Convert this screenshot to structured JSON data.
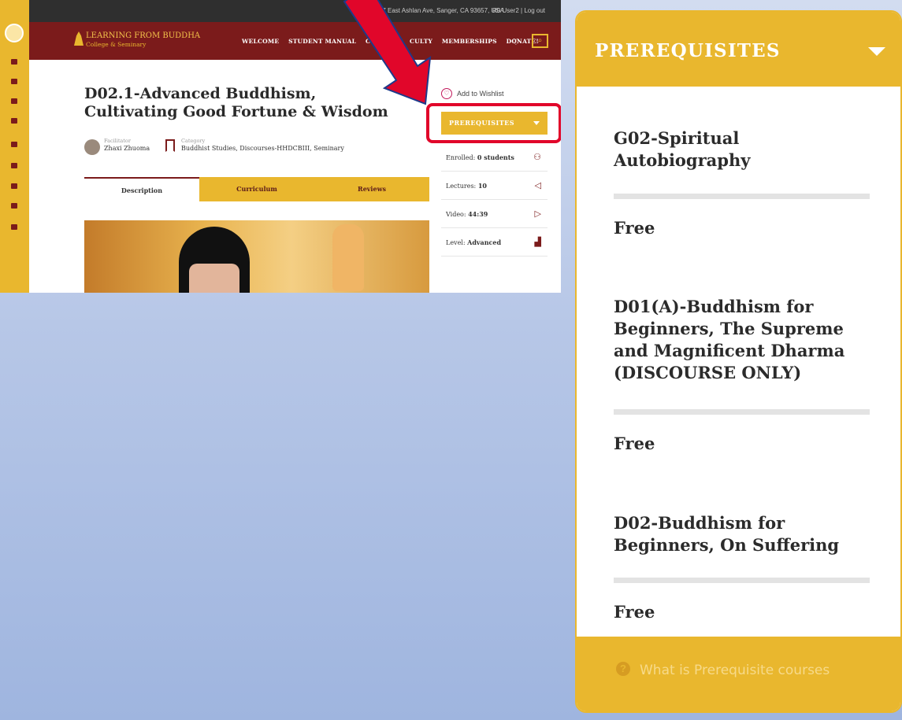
{
  "screenshot": {
    "top_bar": {
      "address": "7007 East Ashlan Ave, Sanger, CA 93657, USA",
      "user": "R0 User2  |  Log out"
    },
    "brand": {
      "name": "LEARNING FROM BUDDHA",
      "subtitle": "College & Seminary"
    },
    "menu": [
      "WELCOME",
      "STUDENT MANUAL",
      "C",
      "CULTY",
      "MEMBERSHIPS",
      "DONATE!"
    ],
    "course_title": "D02.1-Advanced Buddhism, Cultivating Good Fortune & Wisdom",
    "facilitator": {
      "label": "Facilitator",
      "name": "Zhaxi Zhuoma"
    },
    "category": {
      "label": "Category",
      "value": "Buddhist Studies, Discourses-HHDCBIII, Seminary"
    },
    "tabs": [
      "Description",
      "Curriculum",
      "Reviews"
    ],
    "wishlist": "Add to Wishlist",
    "prereq_button": "PREREQUISITES",
    "stats": {
      "enrolled_label": "Enrolled:",
      "enrolled_value": "0 students",
      "lectures_label": "Lectures:",
      "lectures_value": "10",
      "video_label": "Video:",
      "video_value": "44:39",
      "level_label": "Level:",
      "level_value": "Advanced"
    },
    "icons": [
      "menu-icon",
      "users-icon",
      "megaphone-icon",
      "video-icon",
      "chart-icon",
      "heart-icon",
      "search-icon",
      "bookmark-icon"
    ]
  },
  "panel": {
    "title": "PREREQUISITES",
    "courses": [
      {
        "name": "G02-Spiritual Autobiography",
        "price": "Free"
      },
      {
        "name": "D01(A)-Buddhism for Beginners, The Supreme and Magnificent Dharma (DISCOURSE ONLY)",
        "price": "Free"
      },
      {
        "name": "D02-Buddhism for Beginners, On Suffering",
        "price": "Free"
      }
    ],
    "footer_link": "What is Prerequisite courses"
  },
  "colors": {
    "brand_gold": "#e9b72e",
    "brand_maroon": "#7b1b1b",
    "highlight_red": "#e1062a"
  }
}
